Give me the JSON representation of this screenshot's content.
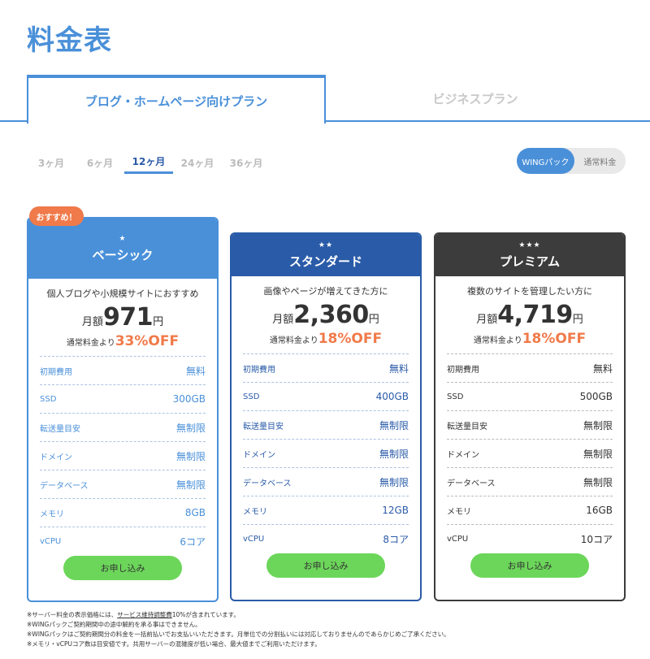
{
  "title": "料金表",
  "main_tabs": [
    {
      "label": "ブログ・ホームページ向けプラン",
      "active": true
    },
    {
      "label": "ビジネスプラン",
      "active": false
    }
  ],
  "periods": [
    {
      "label": "3ヶ月",
      "active": false
    },
    {
      "label": "6ヶ月",
      "active": false
    },
    {
      "label": "12ヶ月",
      "active": true
    },
    {
      "label": "24ヶ月",
      "active": false
    },
    {
      "label": "36ヶ月",
      "active": false
    }
  ],
  "toggle": {
    "on": "WINGパック",
    "off": "通常料金"
  },
  "recommend_badge": "おすすめ！",
  "spec_labels": [
    "初期費用",
    "SSD",
    "転送量目安",
    "ドメイン",
    "データベース",
    "メモリ",
    "vCPU"
  ],
  "plans": [
    {
      "stars": "★",
      "name": "ベーシック",
      "tagline": "個人ブログや小規模サイトにおすすめ",
      "price_pre": "月額",
      "price": "971",
      "price_post": "円",
      "discount_pre": "通常料金より",
      "discount": "33%OFF",
      "specs": [
        "無料",
        "300GB",
        "無制限",
        "無制限",
        "無制限",
        "8GB",
        "6コア"
      ],
      "button": "お申し込み"
    },
    {
      "stars": "★★",
      "name": "スタンダード",
      "tagline": "画像やページが増えてきた方に",
      "price_pre": "月額",
      "price": "2,360",
      "price_post": "円",
      "discount_pre": "通常料金より",
      "discount": "18%OFF",
      "specs": [
        "無料",
        "400GB",
        "無制限",
        "無制限",
        "無制限",
        "12GB",
        "8コア"
      ],
      "button": "お申し込み"
    },
    {
      "stars": "★★★",
      "name": "プレミアム",
      "tagline": "複数のサイトを管理したい方に",
      "price_pre": "月額",
      "price": "4,719",
      "price_post": "円",
      "discount_pre": "通常料金より",
      "discount": "18%OFF",
      "specs": [
        "無料",
        "500GB",
        "無制限",
        "無制限",
        "無制限",
        "16GB",
        "10コア"
      ],
      "button": "お申し込み"
    }
  ],
  "notes": {
    "n1_pre": "※サーバー料金の表示価格には、",
    "n1_link": "サービス維持調整費",
    "n1_post": "10%が含まれています。",
    "n2": "※WINGパックご契約期間中の途中解約を承る事はできません。",
    "n3": "※WINGパックはご契約期間分の料金を一括前払いでお支払いいただきます。月単位での分割払いには対応しておりませんのであらかじめご了承ください。",
    "n4": "※メモリ・vCPUコア数は目安値です。共用サーバーの混雑度が低い場合、最大値までご利用いただけます。"
  }
}
